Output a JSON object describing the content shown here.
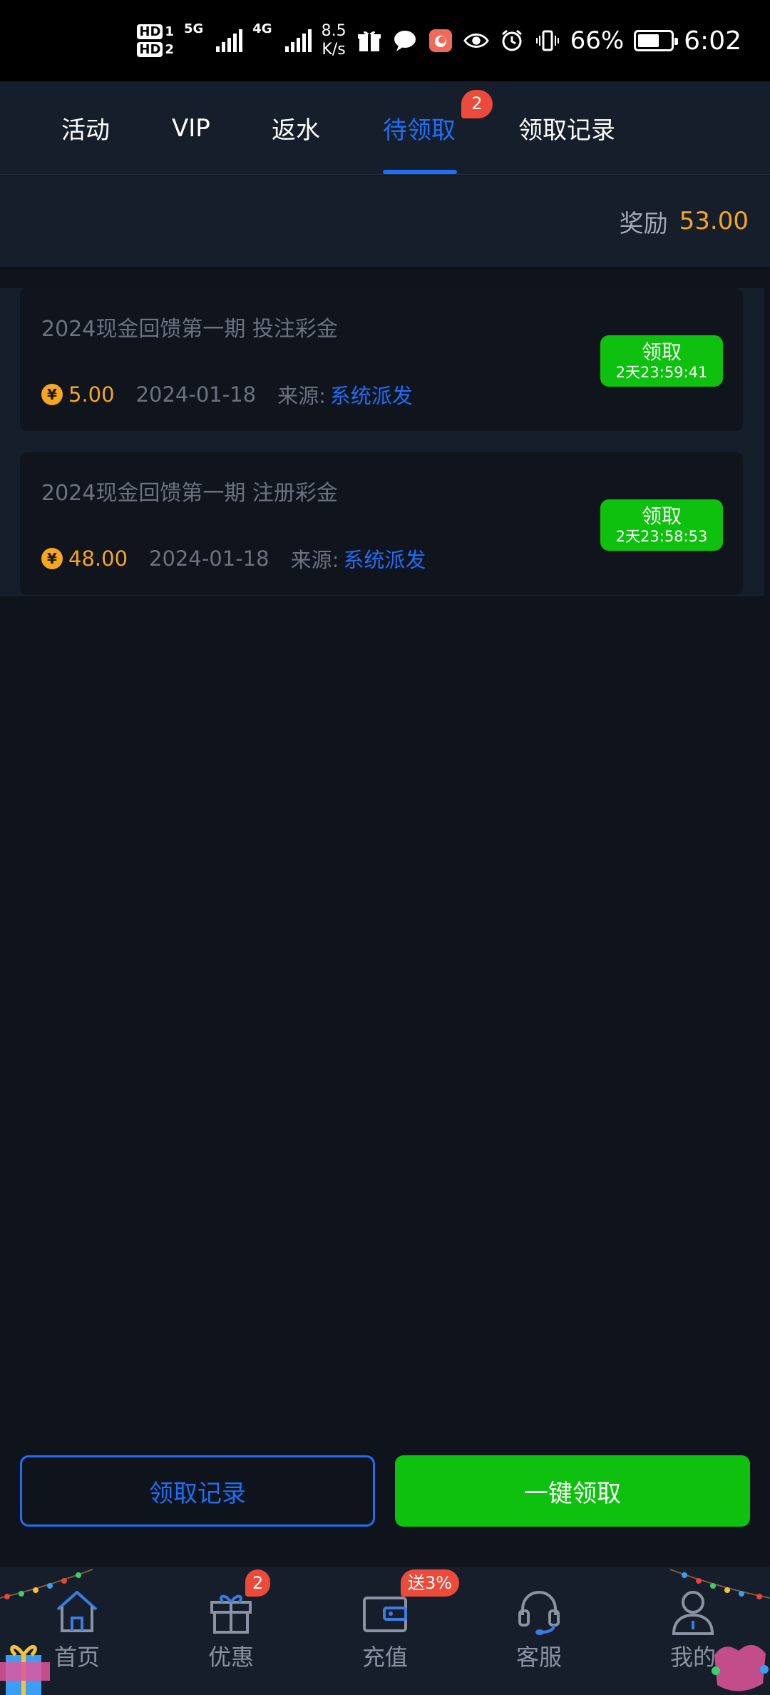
{
  "status_bar": {
    "hd1": "HD",
    "hd1_sub": "1",
    "hd2": "HD",
    "hd2_sub": "2",
    "net1": "5G",
    "net2": "4G",
    "speed": "8.5",
    "speed_unit": "K/s",
    "battery": "66%",
    "battery_level": 0.66,
    "time": "6:02"
  },
  "tabs": [
    {
      "label": "活动",
      "active": false
    },
    {
      "label": "VIP",
      "active": false
    },
    {
      "label": "返水",
      "active": false
    },
    {
      "label": "待领取",
      "active": true,
      "badge": "2"
    },
    {
      "label": "领取记录",
      "active": false
    }
  ],
  "summary": {
    "label": "奖励",
    "value": "53.00"
  },
  "rewards": [
    {
      "title": "2024现金回馈第一期 投注彩金",
      "currency_icon": "¥",
      "amount": "5.00",
      "date": "2024-01-18",
      "source_label": "来源:",
      "source": "系统派发",
      "button_label": "领取",
      "countdown": "2天23:59:41"
    },
    {
      "title": "2024现金回馈第一期 注册彩金",
      "currency_icon": "¥",
      "amount": "48.00",
      "date": "2024-01-18",
      "source_label": "来源:",
      "source": "系统派发",
      "button_label": "领取",
      "countdown": "2天23:58:53"
    }
  ],
  "actions": {
    "records_label": "领取记录",
    "claim_all_label": "一键领取"
  },
  "bottom_nav": [
    {
      "label": "首页",
      "icon": "home-icon"
    },
    {
      "label": "优惠",
      "icon": "gift-icon",
      "badge": "2"
    },
    {
      "label": "充值",
      "icon": "wallet-icon",
      "badge": "送3%"
    },
    {
      "label": "客服",
      "icon": "headset-icon"
    },
    {
      "label": "我的",
      "icon": "user-icon"
    }
  ],
  "colors": {
    "accent_blue": "#1f6ef5",
    "green": "#0ec10e",
    "gold": "#f5a623",
    "badge_red": "#ec4a3a"
  }
}
